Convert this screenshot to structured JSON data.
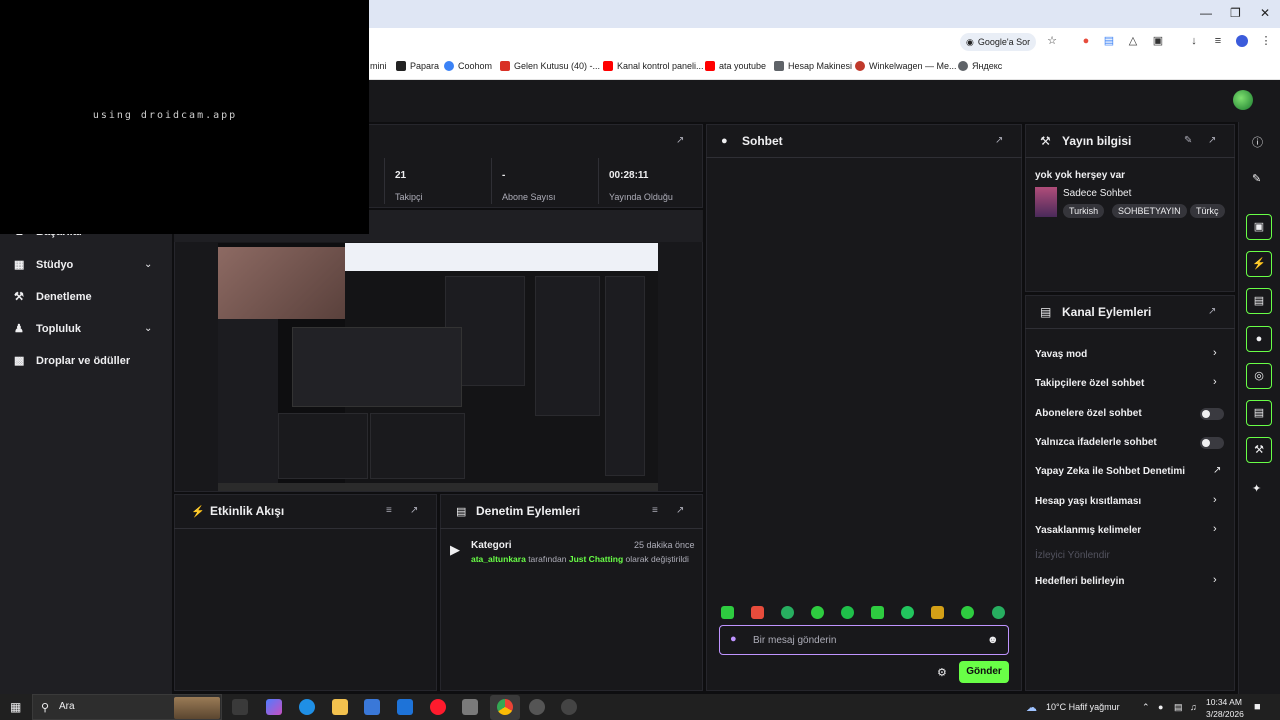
{
  "browser": {
    "google_ask": "Google'a Sor",
    "bookmarks": [
      "mini",
      "Papara",
      "Coohom",
      "Gelen Kutusu (40) -...",
      "Kanal kontrol paneli...",
      "ata youtube",
      "Hesap Makinesi",
      "Winkelwagen — Me...",
      "Яндекс"
    ],
    "bookmark_colors": [
      "#999999",
      "#222222",
      "#3b82f6",
      "#d93025",
      "#ff0000",
      "#ff0000",
      "#5f6368",
      "#c0392b",
      "#5f6368"
    ]
  },
  "webcam": {
    "text": "using droidcam.app"
  },
  "nav": {
    "partial_item": "Başarılar",
    "items": [
      {
        "label": "Stüdyo",
        "icon": "studio-icon",
        "expandable": true
      },
      {
        "label": "Denetleme",
        "icon": "wrench-icon",
        "expandable": false
      },
      {
        "label": "Topluluk",
        "icon": "community-icon",
        "expandable": true
      },
      {
        "label": "Droplar ve ödüller",
        "icon": "drops-icon",
        "expandable": false
      }
    ]
  },
  "stats": [
    {
      "value": "21",
      "label": "Takipçi"
    },
    {
      "value": "-",
      "label": "Abone Sayısı"
    },
    {
      "value": "00:28:11",
      "label": "Yayında Olduğu"
    }
  ],
  "activity": {
    "title": "Etkinlik Akışı"
  },
  "mod_actions": {
    "title": "Denetim Eylemleri",
    "entry": {
      "title": "Kategori",
      "time": "25 dakika önce",
      "user": "ata_altunkara",
      "middle": "tarafından",
      "category": "Just Chatting",
      "end": "olarak değiştirildi"
    }
  },
  "chat": {
    "title": "Sohbet",
    "placeholder": "Bir mesaj gönderin",
    "send": "Gönder"
  },
  "stream_info": {
    "title": "Yayın bilgisi",
    "stream_title": "yok yok herşey var",
    "category": "Sadece Sohbet",
    "tags": [
      "Turkish",
      "SOHBETYAYIN",
      "Türkç"
    ]
  },
  "channel_actions": {
    "title": "Kanal Eylemleri",
    "items": [
      {
        "label": "Yavaş mod",
        "control": "chevron"
      },
      {
        "label": "Takipçilere özel sohbet",
        "control": "chevron"
      },
      {
        "label": "Abonelere özel sohbet",
        "control": "toggle"
      },
      {
        "label": "Yalnızca ifadelerle sohbet",
        "control": "toggle"
      },
      {
        "label": "Yapay Zeka ile Sohbet Denetimi",
        "control": "external"
      },
      {
        "label": "Hesap yaşı kısıtlaması",
        "control": "chevron"
      },
      {
        "label": "Yasaklanmış kelimeler",
        "control": "chevron"
      },
      {
        "label": "İzleyici Yönlendir",
        "control": "disabled"
      },
      {
        "label": "Hedefleri belirleyin",
        "control": "chevron"
      }
    ]
  },
  "taskbar": {
    "search": "Ara",
    "weather": "10°C  Hafif yağmur",
    "time": "10:34 AM",
    "date": "3/28/2026"
  },
  "colors": {
    "accent": "#69ff47",
    "purple": "#bf94ff",
    "bg": "#0e0e10",
    "panel": "#18181b"
  }
}
